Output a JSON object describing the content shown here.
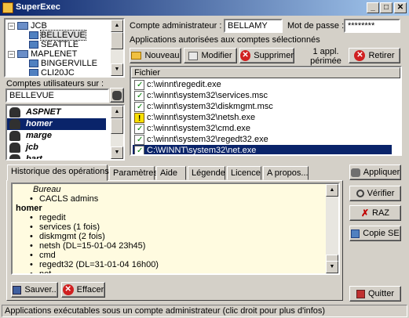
{
  "window": {
    "title": "SuperExec",
    "buttons": [
      "_",
      "□",
      "✕"
    ]
  },
  "tree": {
    "rows": [
      {
        "label": "JCB",
        "type": "group",
        "expander": "−"
      },
      {
        "label": "BELLEVUE",
        "type": "host",
        "selected": true
      },
      {
        "label": "SEATTLE",
        "type": "host"
      },
      {
        "label": "MAPLENET",
        "type": "group",
        "expander": "−"
      },
      {
        "label": "BINGERVILLE",
        "type": "host"
      },
      {
        "label": "CLI20JC",
        "type": "host"
      }
    ]
  },
  "users_panel": {
    "label": "Comptes utilisateurs sur :",
    "host_value": "BELLEVUE",
    "users": [
      "ASPNET",
      "homer",
      "marge",
      "jcb",
      "bart"
    ],
    "selected_user": "homer"
  },
  "admin": {
    "account_label": "Compte administrateur :",
    "account_value": "BELLAMY",
    "password_label": "Mot de passe :",
    "password_value": "********",
    "allowed_label": "Applications autorisées aux comptes sélectionnés"
  },
  "toolbar": {
    "new_label": "Nouveau",
    "edit_label": "Modifier",
    "delete_label": "Supprimer",
    "expired_line1": "1 appl.",
    "expired_line2": "périmée",
    "remove_label": "Retirer"
  },
  "files": {
    "header": "Fichier",
    "rows": [
      {
        "path": "c:\\winnt\\regedit.exe",
        "status": "ok"
      },
      {
        "path": "c:\\winnt\\system32\\services.msc",
        "status": "ok"
      },
      {
        "path": "c:\\winnt\\system32\\diskmgmt.msc",
        "status": "ok"
      },
      {
        "path": "c:\\winnt\\system32\\netsh.exe",
        "status": "warn"
      },
      {
        "path": "c:\\winnt\\system32\\cmd.exe",
        "status": "ok"
      },
      {
        "path": "c:\\winnt\\system32\\regedt32.exe",
        "status": "ok"
      },
      {
        "path": "C:\\WINNT\\system32\\net.exe",
        "status": "selected"
      }
    ]
  },
  "tabs": [
    "Historique des opérations",
    "Paramètres",
    "Aide",
    "Légende",
    "Licence",
    "A propos..."
  ],
  "history": {
    "lines": [
      {
        "kind": "ital",
        "text": "Bureau"
      },
      {
        "kind": "item",
        "text": "CACLS admins"
      },
      {
        "kind": "grp",
        "text": "homer"
      },
      {
        "kind": "item",
        "text": "regedit"
      },
      {
        "kind": "item",
        "text": "services (1 fois)"
      },
      {
        "kind": "item",
        "text": "diskmgmt (2 fois)"
      },
      {
        "kind": "item",
        "text": "netsh (DL=15-01-04 23h45)"
      },
      {
        "kind": "item",
        "text": "cmd"
      },
      {
        "kind": "item",
        "text": "regedt32 (DL=31-01-04 16h00)"
      },
      {
        "kind": "item",
        "text": "net"
      }
    ]
  },
  "bottom_buttons": {
    "save_label": "Sauver..",
    "clear_label": "Effacer"
  },
  "side_buttons": {
    "apply_label": "Appliquer",
    "verify_label": "Vérifier",
    "reset_label": "RAZ",
    "copy_label": "Copie SE",
    "quit_label": "Quitter"
  },
  "status_bar": "Applications exécutables sous un compte administrateur (clic droit pour plus d'infos)",
  "colors": {
    "selection": "#0a246a",
    "history_bg": "#fffbe0",
    "face": "#d4d0c8"
  }
}
